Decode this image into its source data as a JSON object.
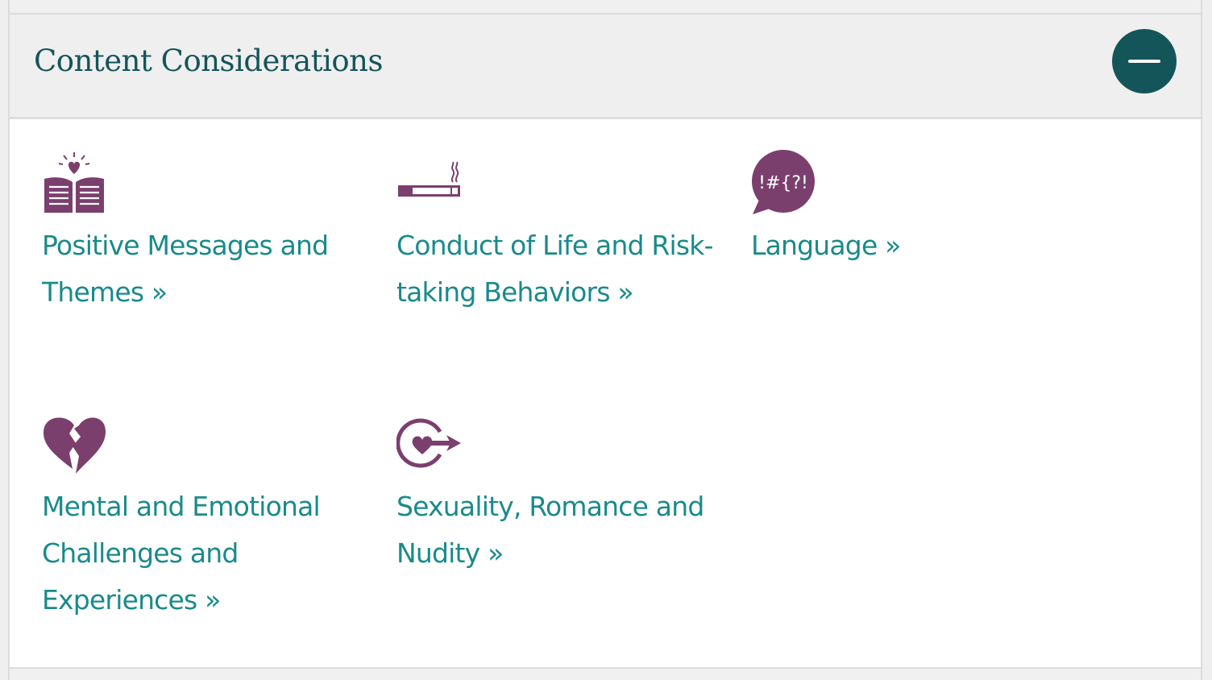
{
  "section": {
    "title": "Content Considerations",
    "collapse_icon": "minus-icon"
  },
  "colors": {
    "title": "#14555a",
    "link": "#1a8a8a",
    "icon": "#7b3f6e",
    "header_bg": "#efefef",
    "button_bg": "#14555a"
  },
  "items": [
    {
      "icon": "open-book-heart-icon",
      "label": "Positive Messages and Themes »"
    },
    {
      "icon": "cigarette-icon",
      "label": "Conduct of Life and Risk-taking Behaviors »"
    },
    {
      "icon": "speech-bubble-icon",
      "icon_text": "!#{?!",
      "label": "Language »"
    },
    {
      "icon": "broken-heart-icon",
      "label": "Mental and Emotional Challenges and Experiences »"
    },
    {
      "icon": "heart-target-arrow-icon",
      "label": "Sexuality, Romance and Nudity »"
    }
  ]
}
